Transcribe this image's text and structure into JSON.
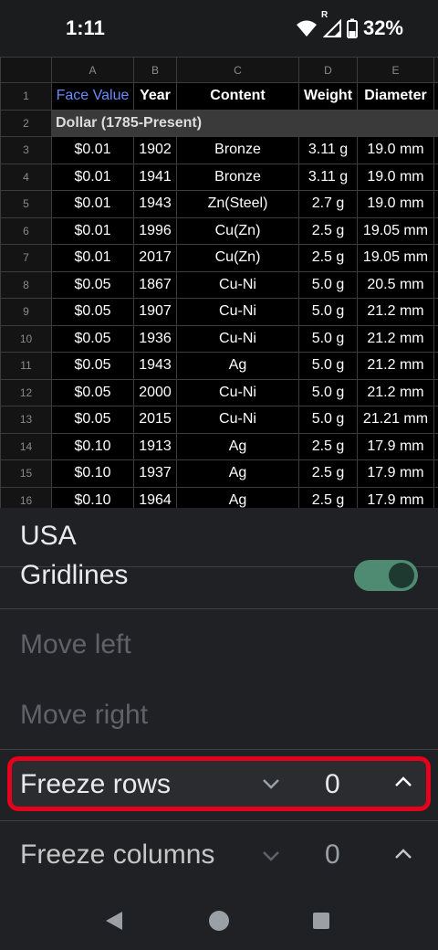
{
  "status_bar": {
    "time": "1:11",
    "battery": "32%",
    "roaming": "R"
  },
  "sheet": {
    "columns": [
      "A",
      "B",
      "C",
      "D",
      "E"
    ],
    "header": {
      "row": "1",
      "cells": [
        "Face Value",
        "Year",
        "Content",
        "Weight",
        "Diameter"
      ]
    },
    "section": {
      "row": "2",
      "label": "Dollar (1785-Present)"
    },
    "rows": [
      {
        "n": "3",
        "cells": [
          "$0.01",
          "1902",
          "Bronze",
          "3.11 g",
          "19.0 mm"
        ]
      },
      {
        "n": "4",
        "cells": [
          "$0.01",
          "1941",
          "Bronze",
          "3.11 g",
          "19.0 mm"
        ]
      },
      {
        "n": "5",
        "cells": [
          "$0.01",
          "1943",
          "Zn(Steel)",
          "2.7 g",
          "19.0 mm"
        ]
      },
      {
        "n": "6",
        "cells": [
          "$0.01",
          "1996",
          "Cu(Zn)",
          "2.5 g",
          "19.05 mm"
        ]
      },
      {
        "n": "7",
        "cells": [
          "$0.01",
          "2017",
          "Cu(Zn)",
          "2.5 g",
          "19.05 mm"
        ]
      },
      {
        "n": "8",
        "cells": [
          "$0.05",
          "1867",
          "Cu-Ni",
          "5.0 g",
          "20.5 mm"
        ]
      },
      {
        "n": "9",
        "cells": [
          "$0.05",
          "1907",
          "Cu-Ni",
          "5.0 g",
          "21.2 mm"
        ]
      },
      {
        "n": "10",
        "cells": [
          "$0.05",
          "1936",
          "Cu-Ni",
          "5.0 g",
          "21.2 mm"
        ]
      },
      {
        "n": "11",
        "cells": [
          "$0.05",
          "1943",
          "Ag",
          "5.0 g",
          "21.2 mm"
        ]
      },
      {
        "n": "12",
        "cells": [
          "$0.05",
          "2000",
          "Cu-Ni",
          "5.0 g",
          "21.2 mm"
        ]
      },
      {
        "n": "13",
        "cells": [
          "$0.05",
          "2015",
          "Cu-Ni",
          "5.0 g",
          "21.21 mm"
        ]
      },
      {
        "n": "14",
        "cells": [
          "$0.10",
          "1913",
          "Ag",
          "2.5 g",
          "17.9 mm"
        ]
      },
      {
        "n": "15",
        "cells": [
          "$0.10",
          "1937",
          "Ag",
          "2.5 g",
          "17.9 mm"
        ]
      },
      {
        "n": "16",
        "cells": [
          "$0.10",
          "1964",
          "Ag",
          "2.5 g",
          "17.9 mm"
        ]
      }
    ]
  },
  "panel": {
    "title": "USA",
    "gridlines_label": "Gridlines",
    "gridlines_on": true,
    "move_left": "Move left",
    "move_right": "Move right",
    "freeze_rows_label": "Freeze rows",
    "freeze_rows_value": "0",
    "freeze_columns_label": "Freeze columns",
    "freeze_columns_value": "0"
  },
  "icons": {
    "wifi": "wifi-icon",
    "signal": "signal-icon",
    "battery": "battery-icon",
    "down": "chevron-down-icon",
    "up": "chevron-up-icon",
    "back": "back-icon",
    "home": "home-icon",
    "recents": "recents-icon"
  },
  "colors": {
    "toggle_on": "#4f8a72",
    "highlight": "#e5001c",
    "link_blue": "#6a8cff"
  }
}
